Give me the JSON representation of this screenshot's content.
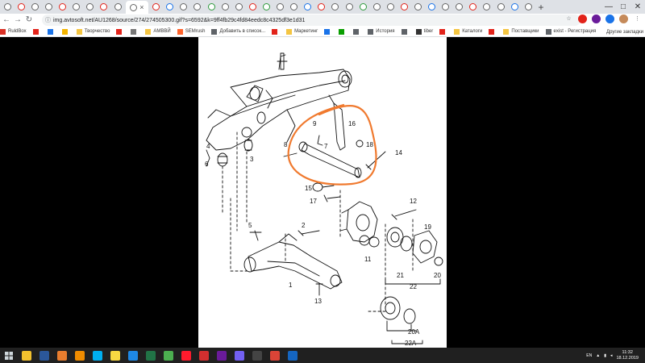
{
  "browser": {
    "url": "img.avtosoft.net/AU1268/source/274/274505300.gif?s=6592&k=9ff4fb29c4fd84eedc8c4325df3e1d31",
    "lock_icon": "info-icon",
    "tab_close": "×",
    "new_tab": "+",
    "window_controls": {
      "minimize": "—",
      "maximize": "□",
      "close": "✕"
    },
    "nav": {
      "back": "←",
      "forward": "→",
      "reload": "↻"
    }
  },
  "bookmarks": [
    {
      "label": "RuldBox",
      "color": "#d93025"
    },
    {
      "label": "",
      "color": "#e2231a"
    },
    {
      "label": "",
      "color": "#1a73e8"
    },
    {
      "label": "",
      "color": "#f4b400"
    },
    {
      "label": "Творчество",
      "color": "#f4c542"
    },
    {
      "label": "",
      "color": "#e2231a"
    },
    {
      "label": "",
      "color": "#777777"
    },
    {
      "label": "АМВВЙ",
      "color": "#f4c542"
    },
    {
      "label": "SEMrush",
      "color": "#ff642d"
    },
    {
      "label": "Добавить в список...",
      "color": "#5f6368"
    },
    {
      "label": "",
      "color": "#e2231a"
    },
    {
      "label": "Маркетинг",
      "color": "#f4c542"
    },
    {
      "label": "",
      "color": "#1a73e8"
    },
    {
      "label": "",
      "color": "#0a9e01"
    },
    {
      "label": "",
      "color": "#5f6368"
    },
    {
      "label": "История",
      "color": "#5f6368"
    },
    {
      "label": "",
      "color": "#5f6368"
    },
    {
      "label": "tiber",
      "color": "#333333"
    },
    {
      "label": "",
      "color": "#e2231a"
    },
    {
      "label": "Каталоги",
      "color": "#f4c542"
    },
    {
      "label": "",
      "color": "#e2231a"
    },
    {
      "label": "Поставщики",
      "color": "#f4c542"
    },
    {
      "label": "exist - Регистрация",
      "color": "#5f6368"
    }
  ],
  "bookmarks_other": "Другие закладки",
  "diagram": {
    "part_labels": [
      "1",
      "2",
      "3",
      "4",
      "5",
      "6",
      "7",
      "8",
      "9",
      "11",
      "12",
      "13",
      "14",
      "15",
      "16",
      "17",
      "18",
      "19",
      "20",
      "20A",
      "21",
      "22",
      "22A"
    ],
    "highlight_color": "#f07a2f"
  },
  "taskbar": {
    "apps": [
      {
        "name": "explorer-icon",
        "color": "#f2c12e"
      },
      {
        "name": "word-icon",
        "color": "#2b579a"
      },
      {
        "name": "media-player-icon",
        "color": "#e87d2e"
      },
      {
        "name": "vlc-icon",
        "color": "#f08c00"
      },
      {
        "name": "skype-icon",
        "color": "#00aff0"
      },
      {
        "name": "sticky-notes-icon",
        "color": "#f7d842"
      },
      {
        "name": "file-manager-icon",
        "color": "#1e88e5"
      },
      {
        "name": "excel-icon",
        "color": "#217346"
      },
      {
        "name": "photos-icon",
        "color": "#4caf50"
      },
      {
        "name": "opera-icon",
        "color": "#ff1b2d"
      },
      {
        "name": "acrobat-icon",
        "color": "#d32f2f"
      },
      {
        "name": "paint-icon",
        "color": "#6a1b9a"
      },
      {
        "name": "viber-icon",
        "color": "#7360f2"
      },
      {
        "name": "camera-icon",
        "color": "#444444"
      },
      {
        "name": "chrome-icon",
        "color": "#db4437"
      },
      {
        "name": "maxthon-icon",
        "color": "#1565c0"
      }
    ],
    "lang": "EN",
    "time": "11:32",
    "date": "18.12.2019"
  }
}
